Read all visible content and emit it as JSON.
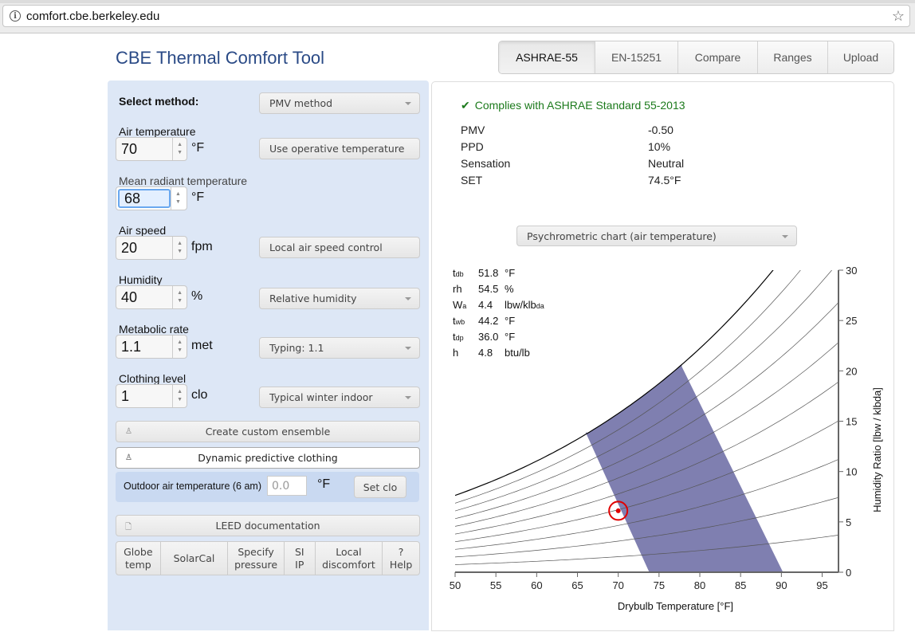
{
  "browser": {
    "url": "comfort.cbe.berkeley.edu",
    "info_icon": "info-icon",
    "bookmark_icon": "star-icon"
  },
  "app": {
    "title": "CBE Thermal Comfort Tool"
  },
  "nav_tabs": [
    {
      "label": "ASHRAE-55",
      "active": true
    },
    {
      "label": "EN-15251",
      "active": false
    },
    {
      "label": "Compare",
      "active": false
    },
    {
      "label": "Ranges",
      "active": false
    },
    {
      "label": "Upload",
      "active": false
    }
  ],
  "inputs": {
    "method_label": "Select method:",
    "method_value": "PMV method",
    "air_temp": {
      "label": "Air temperature",
      "value": "70",
      "unit": "°F",
      "button": "Use operative temperature"
    },
    "mrt": {
      "label": "Mean radiant temperature",
      "value": "68",
      "unit": "°F"
    },
    "air_speed": {
      "label": "Air speed",
      "value": "20",
      "unit": "fpm",
      "button": "Local air speed control"
    },
    "humidity": {
      "label": "Humidity",
      "value": "40",
      "unit": "%",
      "select": "Relative humidity"
    },
    "met": {
      "label": "Metabolic rate",
      "value": "1.1",
      "unit": "met",
      "select": "Typing: 1.1"
    },
    "clo": {
      "label": "Clothing level",
      "value": "1",
      "unit": "clo",
      "select": "Typical winter indoor"
    },
    "custom_ensemble": "Create custom ensemble",
    "dynamic_clothing": "Dynamic predictive clothing",
    "outdoor": {
      "label": "Outdoor air temperature (6 am)",
      "placeholder": "0.0",
      "unit": "°F",
      "button": "Set clo"
    },
    "leed": "LEED documentation",
    "tools": [
      {
        "label": "Globe\ntemp"
      },
      {
        "label": "SolarCal"
      },
      {
        "label": "Specify\npressure"
      },
      {
        "label": "SI\nIP"
      },
      {
        "label": "Local\ndiscomfort"
      },
      {
        "label": "?\nHelp"
      }
    ]
  },
  "results": {
    "compliance_icon": "checkmark-icon",
    "compliance": "Complies with ASHRAE Standard 55-2013",
    "rows": [
      {
        "label": "PMV",
        "value": "-0.50"
      },
      {
        "label": "PPD",
        "value": "10%"
      },
      {
        "label": "Sensation",
        "value": "Neutral"
      },
      {
        "label": "SET",
        "value": "74.5°F"
      }
    ],
    "chart_select": "Psychrometric chart (air temperature)"
  },
  "hover_info": [
    {
      "sym": "t",
      "sub": "db",
      "value": "51.8",
      "unit": "°F",
      "unit_sub": ""
    },
    {
      "sym": "rh",
      "sub": "",
      "value": "54.5",
      "unit": "%",
      "unit_sub": ""
    },
    {
      "sym": "W",
      "sub": "a",
      "value": "4.4",
      "unit": "lbw/klb",
      "unit_sub": "da"
    },
    {
      "sym": "t",
      "sub": "wb",
      "value": "44.2",
      "unit": "°F",
      "unit_sub": ""
    },
    {
      "sym": "t",
      "sub": "dp",
      "value": "36.0",
      "unit": "°F",
      "unit_sub": ""
    },
    {
      "sym": "h",
      "sub": "",
      "value": "4.8",
      "unit": "btu/lb",
      "unit_sub": ""
    }
  ],
  "chart_data": {
    "type": "line",
    "title": "Psychrometric chart (air temperature)",
    "xlabel": "Drybulb Temperature [°F]",
    "ylabel": "Humidity Ratio [lb_w / klb_da]",
    "xlim": [
      50,
      97
    ],
    "ylim": [
      0,
      30
    ],
    "xticks": [
      50,
      55,
      60,
      65,
      70,
      75,
      80,
      85,
      90,
      95
    ],
    "yticks": [
      0,
      5,
      10,
      15,
      20,
      25,
      30
    ],
    "rh_curves": [
      10,
      20,
      30,
      40,
      50,
      60,
      70,
      80,
      90,
      100
    ],
    "comfort_zone": {
      "color": "#7f7fb0",
      "polygon": [
        [
          73.8,
          0
        ],
        [
          90.2,
          0
        ],
        [
          77.8,
          20.4
        ],
        [
          66.0,
          13.9
        ]
      ]
    },
    "current_point": {
      "x": 70,
      "y": 6.1,
      "color": "#e00000"
    },
    "grid": false,
    "legend": "none"
  }
}
